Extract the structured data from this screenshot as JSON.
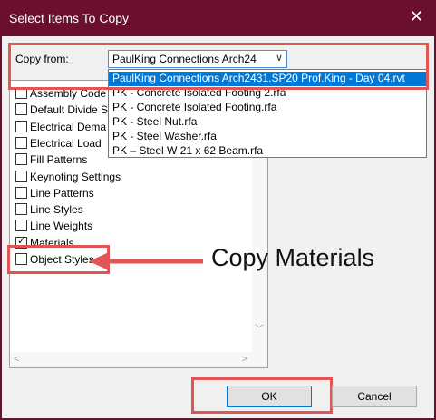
{
  "window": {
    "title": "Select Items To Copy",
    "close_glyph": "✕"
  },
  "copy_from": {
    "label": "Copy from:",
    "selected": "PaulKing Connections Arch24",
    "chevron": "∨",
    "options": [
      "PaulKing Connections Arch2431.SP20 Prof.King - Day 04.rvt",
      "PK - Concrete Isolated Footing 2.rfa",
      "PK - Concrete Isolated Footing.rfa",
      "PK - Steel Nut.rfa",
      "PK - Steel Washer.rfa",
      "PK – Steel W 21 x 62 Beam.rfa"
    ],
    "highlighted_index": 0
  },
  "items": [
    {
      "label": "Assembly Code",
      "checked": false
    },
    {
      "label": "Default Divide S",
      "checked": false
    },
    {
      "label": "Electrical Dema",
      "checked": false
    },
    {
      "label": "Electrical Load",
      "checked": false
    },
    {
      "label": "Fill Patterns",
      "checked": false
    },
    {
      "label": "Keynoting Settings",
      "checked": false
    },
    {
      "label": "Line Patterns",
      "checked": false
    },
    {
      "label": "Line Styles",
      "checked": false
    },
    {
      "label": "Line Weights",
      "checked": false
    },
    {
      "label": "Materials",
      "checked": true
    },
    {
      "label": "Object Styles",
      "checked": false
    }
  ],
  "annotation": {
    "text": "Copy Materials",
    "color": "#e25555"
  },
  "buttons": {
    "ok": "OK",
    "cancel": "Cancel"
  },
  "colors": {
    "titlebar": "#6a0f2e",
    "highlight": "#0078d7",
    "annotation_red": "#e25555"
  }
}
